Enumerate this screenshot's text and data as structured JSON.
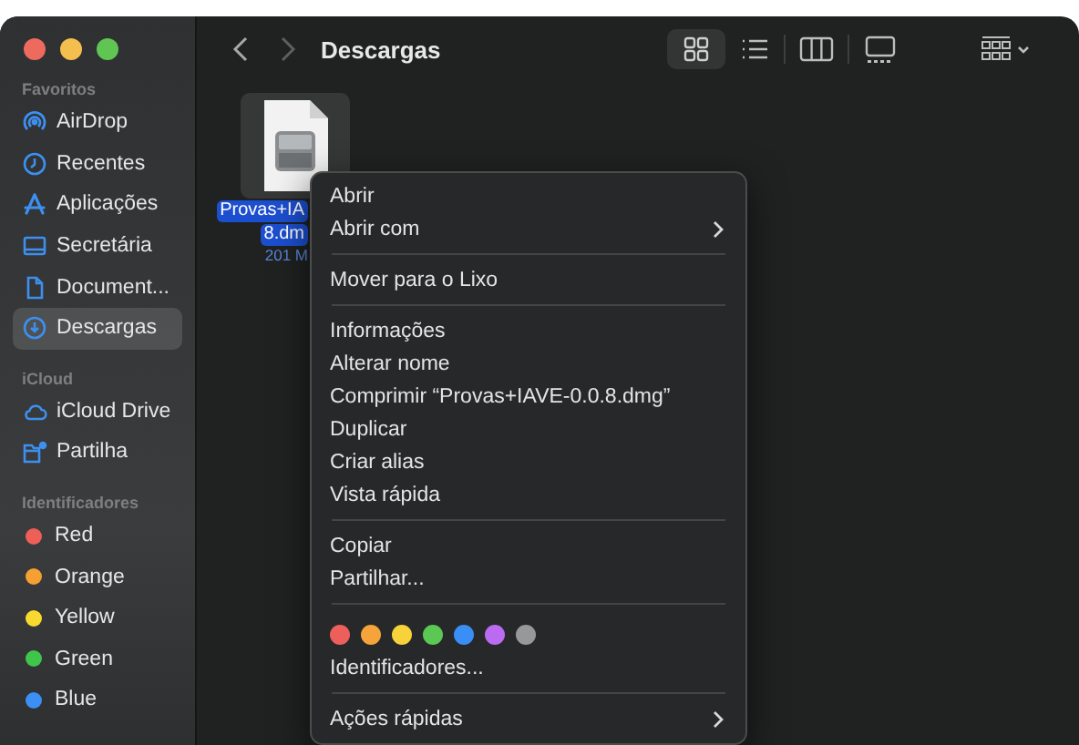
{
  "window": {
    "title": "Descargas",
    "traffic_lights": [
      {
        "color": "#ed6a5e"
      },
      {
        "color": "#f5bf4f"
      },
      {
        "color": "#61c554"
      }
    ]
  },
  "view_buttons": [
    {
      "kind": "icons",
      "selected": true
    },
    {
      "kind": "list",
      "selected": false
    },
    {
      "kind": "columns",
      "selected": false
    },
    {
      "kind": "gallery",
      "selected": false
    },
    {
      "kind": "group",
      "selected": false
    }
  ],
  "sidebar": {
    "sections": [
      {
        "title": "Favoritos",
        "items": [
          {
            "label": "AirDrop",
            "selected": false
          },
          {
            "label": "Recentes",
            "selected": false
          },
          {
            "label": "Aplicações",
            "selected": false
          },
          {
            "label": "Secretária",
            "selected": false
          },
          {
            "label": "Document...",
            "selected": false
          },
          {
            "label": "Descargas",
            "selected": true
          }
        ]
      },
      {
        "title": "iCloud",
        "items": [
          {
            "label": "iCloud Drive",
            "selected": false
          },
          {
            "label": "Partilha",
            "selected": false
          }
        ]
      },
      {
        "title": "Identificadores",
        "items": [
          {
            "label": "Red",
            "color": "#ee5f57",
            "selected": false
          },
          {
            "label": "Orange",
            "color": "#f4a033",
            "selected": false
          },
          {
            "label": "Yellow",
            "color": "#f8d92f",
            "selected": false
          },
          {
            "label": "Green",
            "color": "#3fc54b",
            "selected": false
          },
          {
            "label": "Blue",
            "color": "#3b8ff5",
            "selected": false
          }
        ]
      }
    ]
  },
  "file": {
    "name_lines": [
      "Provas+IA",
      "8.dm"
    ],
    "size": "201 M",
    "selected": true
  },
  "context_menu": {
    "items": [
      {
        "kind": "item",
        "label": "Abrir",
        "submenu": false
      },
      {
        "kind": "item",
        "label": "Abrir com",
        "submenu": true
      },
      {
        "kind": "separator"
      },
      {
        "kind": "item",
        "label": "Mover para o Lixo",
        "submenu": false
      },
      {
        "kind": "separator"
      },
      {
        "kind": "item",
        "label": "Informações",
        "submenu": false
      },
      {
        "kind": "item",
        "label": "Alterar nome",
        "submenu": false
      },
      {
        "kind": "item",
        "label": "Comprimir “Provas+IAVE-0.0.8.dmg”",
        "submenu": false
      },
      {
        "kind": "item",
        "label": "Duplicar",
        "submenu": false
      },
      {
        "kind": "item",
        "label": "Criar alias",
        "submenu": false
      },
      {
        "kind": "item",
        "label": "Vista rápida",
        "submenu": false
      },
      {
        "kind": "separator"
      },
      {
        "kind": "item",
        "label": "Copiar",
        "submenu": false
      },
      {
        "kind": "item",
        "label": "Partilhar...",
        "submenu": false
      },
      {
        "kind": "separator"
      },
      {
        "kind": "tags",
        "colors": [
          {
            "color": "#ec5f5a"
          },
          {
            "color": "#f6a33b"
          },
          {
            "color": "#f7d23a"
          },
          {
            "color": "#5bc853"
          },
          {
            "color": "#3a8ef6"
          },
          {
            "color": "#bb6bf1"
          },
          {
            "color": "#98989b"
          }
        ]
      },
      {
        "kind": "item",
        "label": "Identificadores...",
        "submenu": false
      },
      {
        "kind": "separator"
      },
      {
        "kind": "item",
        "label": "Ações rápidas",
        "submenu": true
      }
    ]
  }
}
